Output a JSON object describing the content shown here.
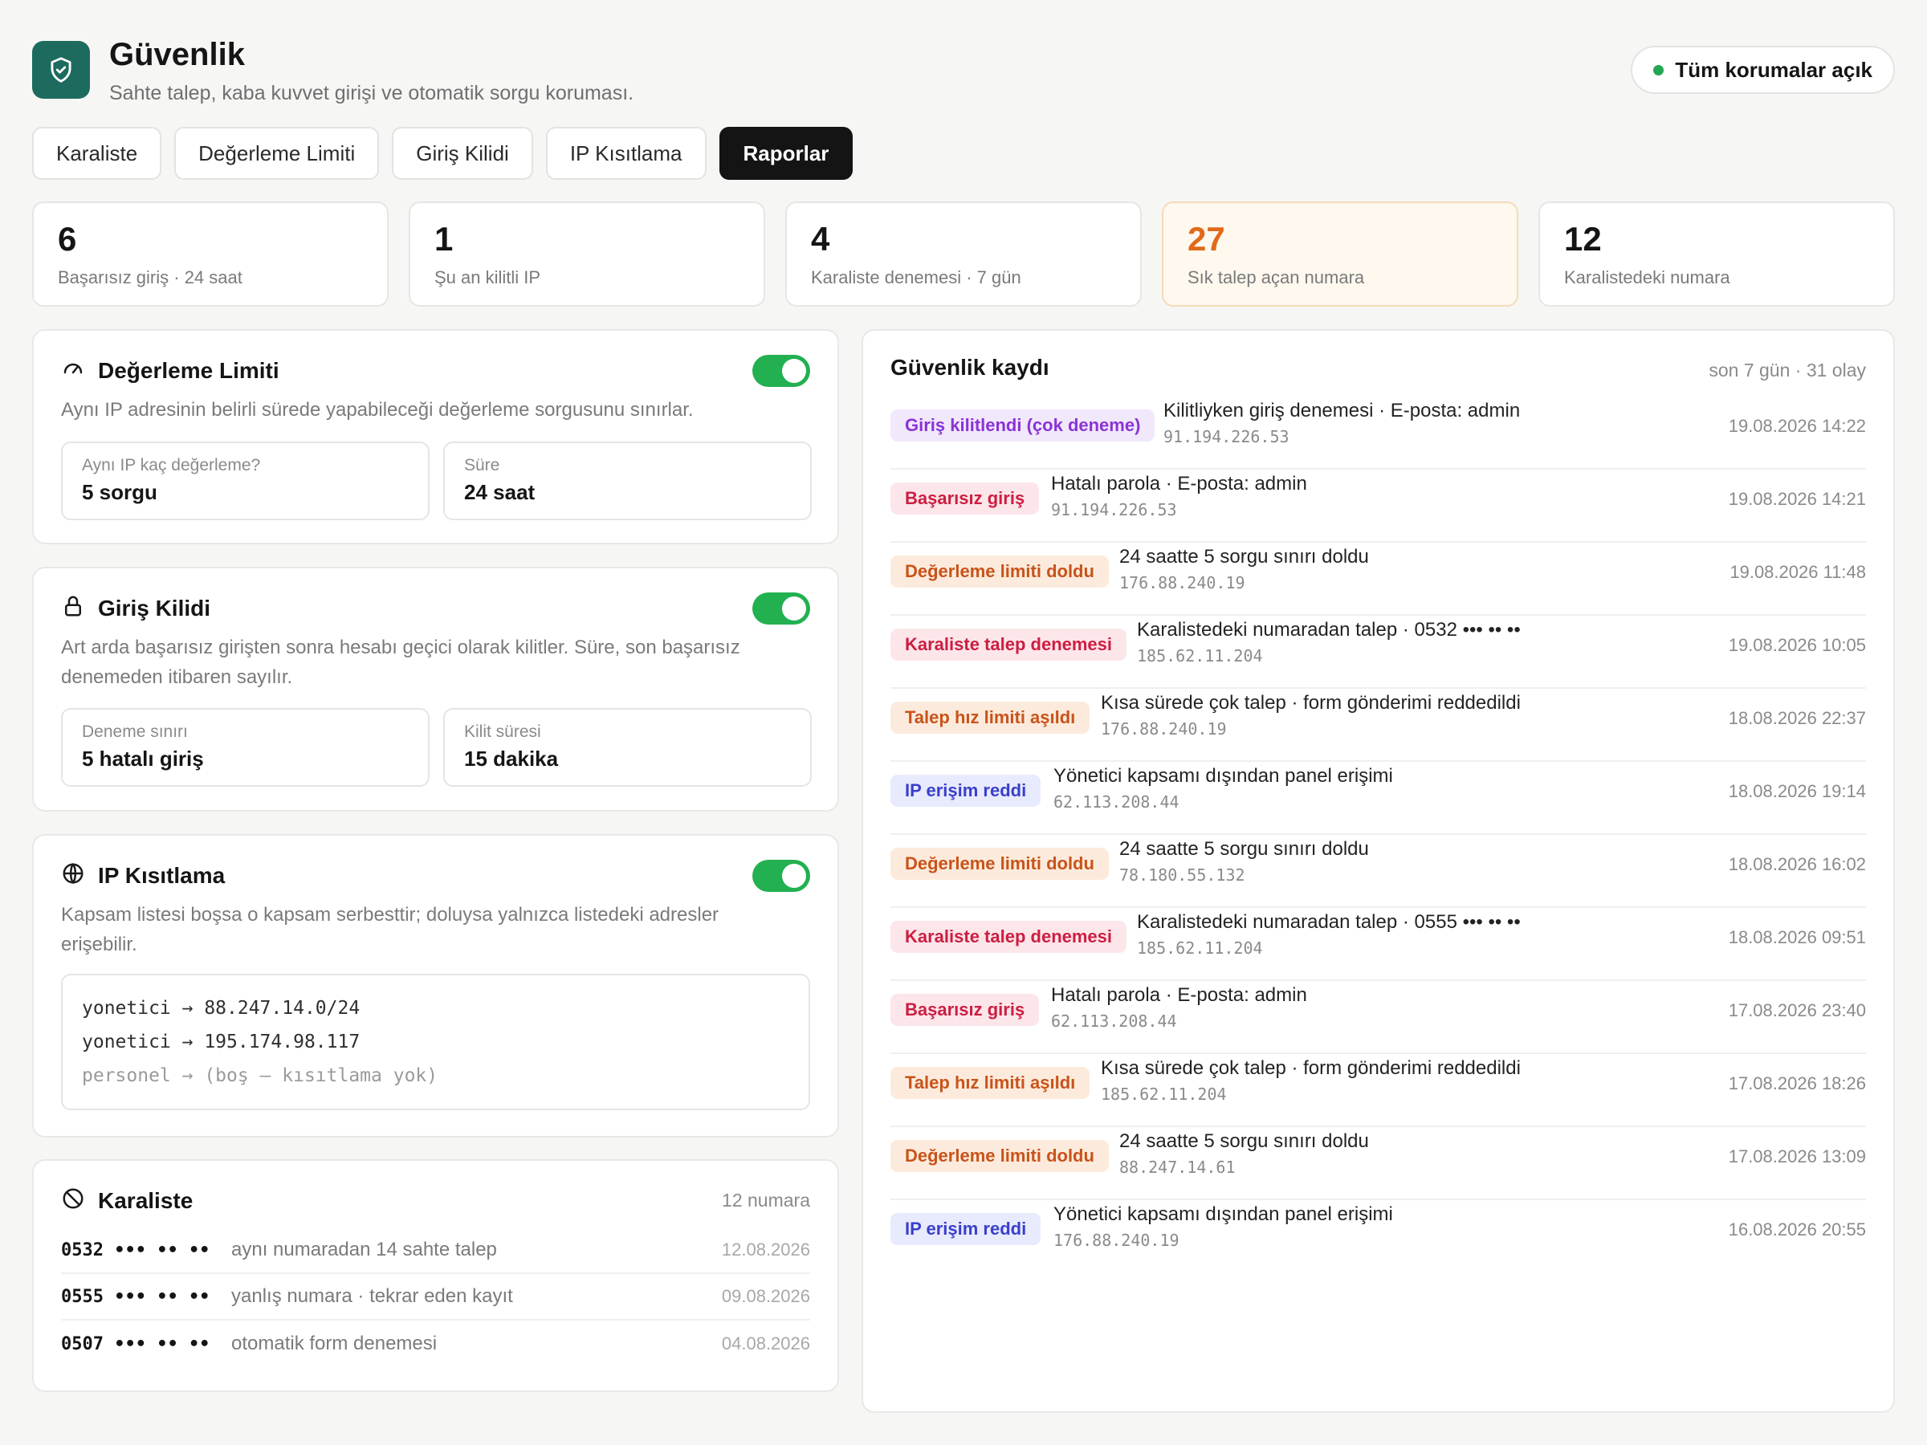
{
  "header": {
    "title": "Güvenlik",
    "subtitle": "Sahte talep, kaba kuvvet girişi ve otomatik sorgu koruması.",
    "status": "Tüm korumalar açık"
  },
  "tabs": [
    "Karaliste",
    "Değerleme Limiti",
    "Giriş Kilidi",
    "IP Kısıtlama",
    "Raporlar"
  ],
  "active_tab": "Raporlar",
  "stats": [
    {
      "value": "6",
      "label": "Başarısız giriş · 24 saat"
    },
    {
      "value": "1",
      "label": "Şu an kilitli IP"
    },
    {
      "value": "4",
      "label": "Karaliste denemesi · 7 gün"
    },
    {
      "value": "27",
      "label": "Sık talep açan numara"
    },
    {
      "value": "12",
      "label": "Karalistedeki numara"
    }
  ],
  "rate_limit": {
    "title": "Değerleme Limiti",
    "enabled": true,
    "desc": "Aynı IP adresinin belirli sürede yapabileceği değerleme sorgusunu sınırlar.",
    "fields": [
      {
        "label": "Aynı IP kaç değerleme?",
        "value": "5 sorgu"
      },
      {
        "label": "Süre",
        "value": "24 saat"
      }
    ]
  },
  "login_lock": {
    "title": "Giriş Kilidi",
    "enabled": true,
    "desc": "Art arda başarısız girişten sonra hesabı geçici olarak kilitler. Süre, son başarısız denemeden itibaren sayılır.",
    "fields": [
      {
        "label": "Deneme sınırı",
        "value": "5 hatalı giriş"
      },
      {
        "label": "Kilit süresi",
        "value": "15 dakika"
      }
    ]
  },
  "ip_restrict": {
    "title": "IP Kısıtlama",
    "enabled": true,
    "desc": "Kapsam listesi boşsa o kapsam serbesttir; doluysa yalnızca listedeki adresler erişebilir.",
    "rules": [
      "yonetici → 88.247.14.0/24",
      "yonetici → 195.174.98.117",
      "personel → (boş — kısıtlama yok)"
    ]
  },
  "blacklist": {
    "title": "Karaliste",
    "count": "12 numara",
    "items": [
      {
        "number": "0532 ••• •• ••",
        "reason": "aynı numaradan 14 sahte talep",
        "date": "12.08.2026"
      },
      {
        "number": "0555 ••• •• ••",
        "reason": "yanlış numara · tekrar eden kayıt",
        "date": "09.08.2026"
      },
      {
        "number": "0507 ••• •• ••",
        "reason": "otomatik form denemesi",
        "date": "04.08.2026"
      }
    ]
  },
  "log": {
    "title": "Güvenlik kaydı",
    "meta": "son 7 gün · 31 olay",
    "entries": [
      {
        "badge": "Giriş kilitlendi (çok deneme)",
        "kind": "purple",
        "text": "Kilitliyken giriş denemesi · E-posta: admin",
        "ip": "91.194.226.53",
        "time": "19.08.2026 14:22"
      },
      {
        "badge": "Başarısız giriş",
        "kind": "red",
        "text": "Hatalı parola · E-posta: admin",
        "ip": "91.194.226.53",
        "time": "19.08.2026 14:21"
      },
      {
        "badge": "Değerleme limiti doldu",
        "kind": "orange",
        "text": "24 saatte 5 sorgu sınırı doldu",
        "ip": "176.88.240.19",
        "time": "19.08.2026 11:48"
      },
      {
        "badge": "Karaliste talep denemesi",
        "kind": "red",
        "text": "Karalistedeki numaradan talep · 0532 ••• •• ••",
        "ip": "185.62.11.204",
        "time": "19.08.2026 10:05"
      },
      {
        "badge": "Talep hız limiti aşıldı",
        "kind": "orange",
        "text": "Kısa sürede çok talep · form gönderimi reddedildi",
        "ip": "176.88.240.19",
        "time": "18.08.2026 22:37"
      },
      {
        "badge": "IP erişim reddi",
        "kind": "blue",
        "text": "Yönetici kapsamı dışından panel erişimi",
        "ip": "62.113.208.44",
        "time": "18.08.2026 19:14"
      },
      {
        "badge": "Değerleme limiti doldu",
        "kind": "orange",
        "text": "24 saatte 5 sorgu sınırı doldu",
        "ip": "78.180.55.132",
        "time": "18.08.2026 16:02"
      },
      {
        "badge": "Karaliste talep denemesi",
        "kind": "red",
        "text": "Karalistedeki numaradan talep · 0555 ••• •• ••",
        "ip": "185.62.11.204",
        "time": "18.08.2026 09:51"
      },
      {
        "badge": "Başarısız giriş",
        "kind": "red",
        "text": "Hatalı parola · E-posta: admin",
        "ip": "62.113.208.44",
        "time": "17.08.2026 23:40"
      },
      {
        "badge": "Talep hız limiti aşıldı",
        "kind": "orange",
        "text": "Kısa sürede çok talep · form gönderimi reddedildi",
        "ip": "185.62.11.204",
        "time": "17.08.2026 18:26"
      },
      {
        "badge": "Değerleme limiti doldu",
        "kind": "orange",
        "text": "24 saatte 5 sorgu sınırı doldu",
        "ip": "88.247.14.61",
        "time": "17.08.2026 13:09"
      },
      {
        "badge": "IP erişim reddi",
        "kind": "blue",
        "text": "Yönetici kapsamı dışından panel erişimi",
        "ip": "176.88.240.19",
        "time": "16.08.2026 20:55"
      }
    ]
  }
}
